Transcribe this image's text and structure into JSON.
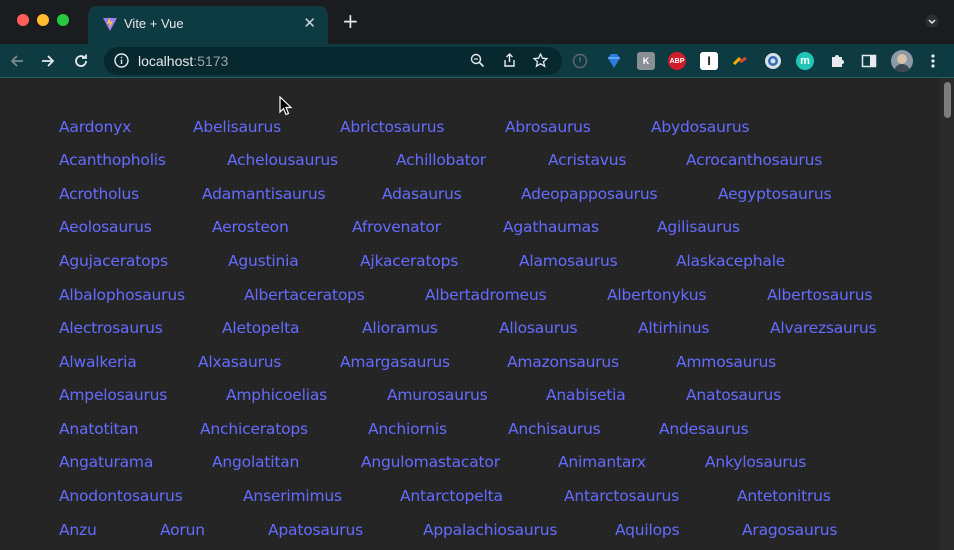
{
  "browser": {
    "tab_title": "Vite + Vue",
    "tab_close": "✕",
    "new_tab": "+",
    "url_host": "localhost",
    "url_port": ":5173"
  },
  "links": [
    "Aardonyx",
    "Abelisaurus",
    "Abrictosaurus",
    "Abrosaurus",
    "Abydosaurus",
    "Acanthopholis",
    "Achelousaurus",
    "Achillobator",
    "Acristavus",
    "Acrocanthosaurus",
    "Acrotholus",
    "Adamantisaurus",
    "Adasaurus",
    "Adeopapposaurus",
    "Aegyptosaurus",
    "Aeolosaurus",
    "Aerosteon",
    "Afrovenator",
    "Agathaumas",
    "Agilisaurus",
    "Agujaceratops",
    "Agustinia",
    "Ajkaceratops",
    "Alamosaurus",
    "Alaskacephale",
    "Albalophosaurus",
    "Albertaceratops",
    "Albertadromeus",
    "Albertonykus",
    "Albertosaurus",
    "Alectrosaurus",
    "Aletopelta",
    "Alioramus",
    "Allosaurus",
    "Altirhinus",
    "Alvarezsaurus",
    "Alwalkeria",
    "Alxasaurus",
    "Amargasaurus",
    "Amazonsaurus",
    "Ammosaurus",
    "Ampelosaurus",
    "Amphicoelias",
    "Amurosaurus",
    "Anabisetia",
    "Anatosaurus",
    "Anatotitan",
    "Anchiceratops",
    "Anchiornis",
    "Anchisaurus",
    "Andesaurus",
    "Angaturama",
    "Angolatitan",
    "Angulomastacator",
    "Animantarx",
    "Ankylosaurus",
    "Anodontosaurus",
    "Anserimimus",
    "Antarctopelta",
    "Antarctosaurus",
    "Antetonitrus",
    "Anzu",
    "Aorun",
    "Apatosaurus",
    "Appalachiosaurus",
    "Aquilops",
    "Aragosaurus"
  ],
  "colors": {
    "link": "#646cff",
    "background": "#242424",
    "toolbar": "#0e3a41"
  }
}
